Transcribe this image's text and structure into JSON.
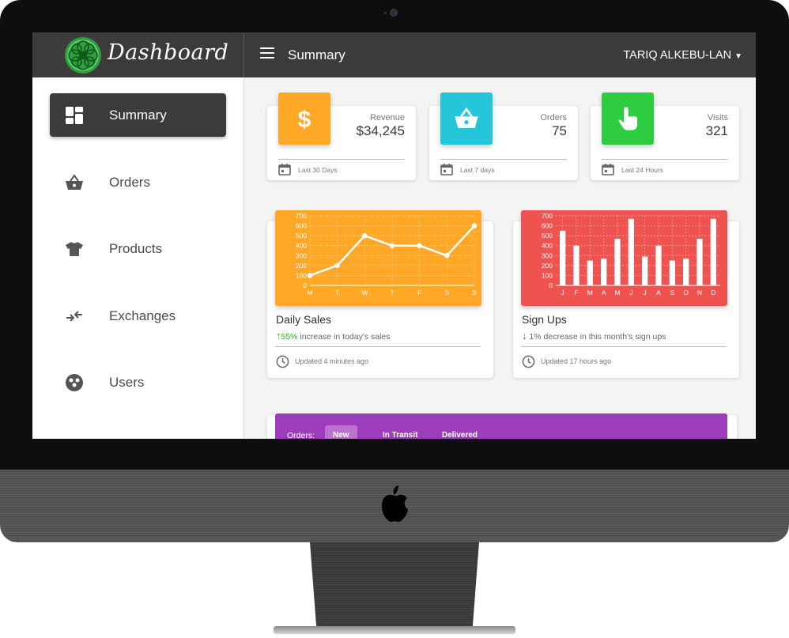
{
  "app": {
    "title": "Dashboard",
    "page_title": "Summary",
    "user_name": "TARIQ ALKEBU-LAN",
    "user_caret": "▼"
  },
  "sidebar": {
    "items": [
      {
        "label": "Summary",
        "icon": "dashboard-icon",
        "active": true
      },
      {
        "label": "Orders",
        "icon": "basket-icon",
        "active": false
      },
      {
        "label": "Products",
        "icon": "tshirt-icon",
        "active": false
      },
      {
        "label": "Exchanges",
        "icon": "exchange-icon",
        "active": false
      },
      {
        "label": "Users",
        "icon": "users-icon",
        "active": false
      }
    ]
  },
  "stats": [
    {
      "label": "Revenue",
      "value": "$34,245",
      "footer": "Last 30 Days",
      "icon": "dollar-icon",
      "color": "#ffa726"
    },
    {
      "label": "Orders",
      "value": "75",
      "footer": "Last 7 days",
      "icon": "basket-icon",
      "color": "#26c6da"
    },
    {
      "label": "Visits",
      "value": "321",
      "footer": "Last 24 Hours",
      "icon": "touch-icon",
      "color": "#2ecc40"
    }
  ],
  "daily_sales": {
    "title": "Daily Sales",
    "change_arrow": "↑",
    "change_value": "55%",
    "change_text": " increase in today's sales",
    "footer": "Updated 4 minutes ago",
    "color": "#ffa726"
  },
  "sign_ups": {
    "title": "Sign Ups",
    "change_arrow": "↓",
    "change_text": " 1% decrease in this month's sign ups",
    "footer": "Updated 17 hours ago",
    "color": "#ef5350"
  },
  "chart_data": [
    {
      "type": "line",
      "categories": [
        "M",
        "T",
        "W",
        "T",
        "F",
        "S",
        "S"
      ],
      "values": [
        100,
        200,
        500,
        400,
        400,
        300,
        600
      ],
      "ylim": [
        0,
        700
      ],
      "yticks": [
        0,
        100,
        200,
        300,
        400,
        500,
        600,
        700
      ],
      "grid": true
    },
    {
      "type": "bar",
      "categories": [
        "J",
        "F",
        "M",
        "A",
        "M",
        "J",
        "J",
        "A",
        "S",
        "O",
        "N",
        "D"
      ],
      "values": [
        550,
        400,
        250,
        270,
        470,
        670,
        290,
        400,
        250,
        270,
        470,
        670
      ],
      "ylim": [
        0,
        700
      ],
      "yticks": [
        0,
        100,
        200,
        300,
        400,
        500,
        600,
        700
      ],
      "grid": true
    }
  ],
  "orders_panel": {
    "label": "Orders:",
    "tabs": [
      {
        "label": "New",
        "active": true
      },
      {
        "label": "In Transit",
        "active": false
      },
      {
        "label": "Delivered",
        "active": false
      }
    ],
    "color": "#9e3dbb"
  },
  "colors": {
    "topbar": "#3c3a3b",
    "background": "#f4f4f4",
    "logo": "#2e9e3e"
  }
}
